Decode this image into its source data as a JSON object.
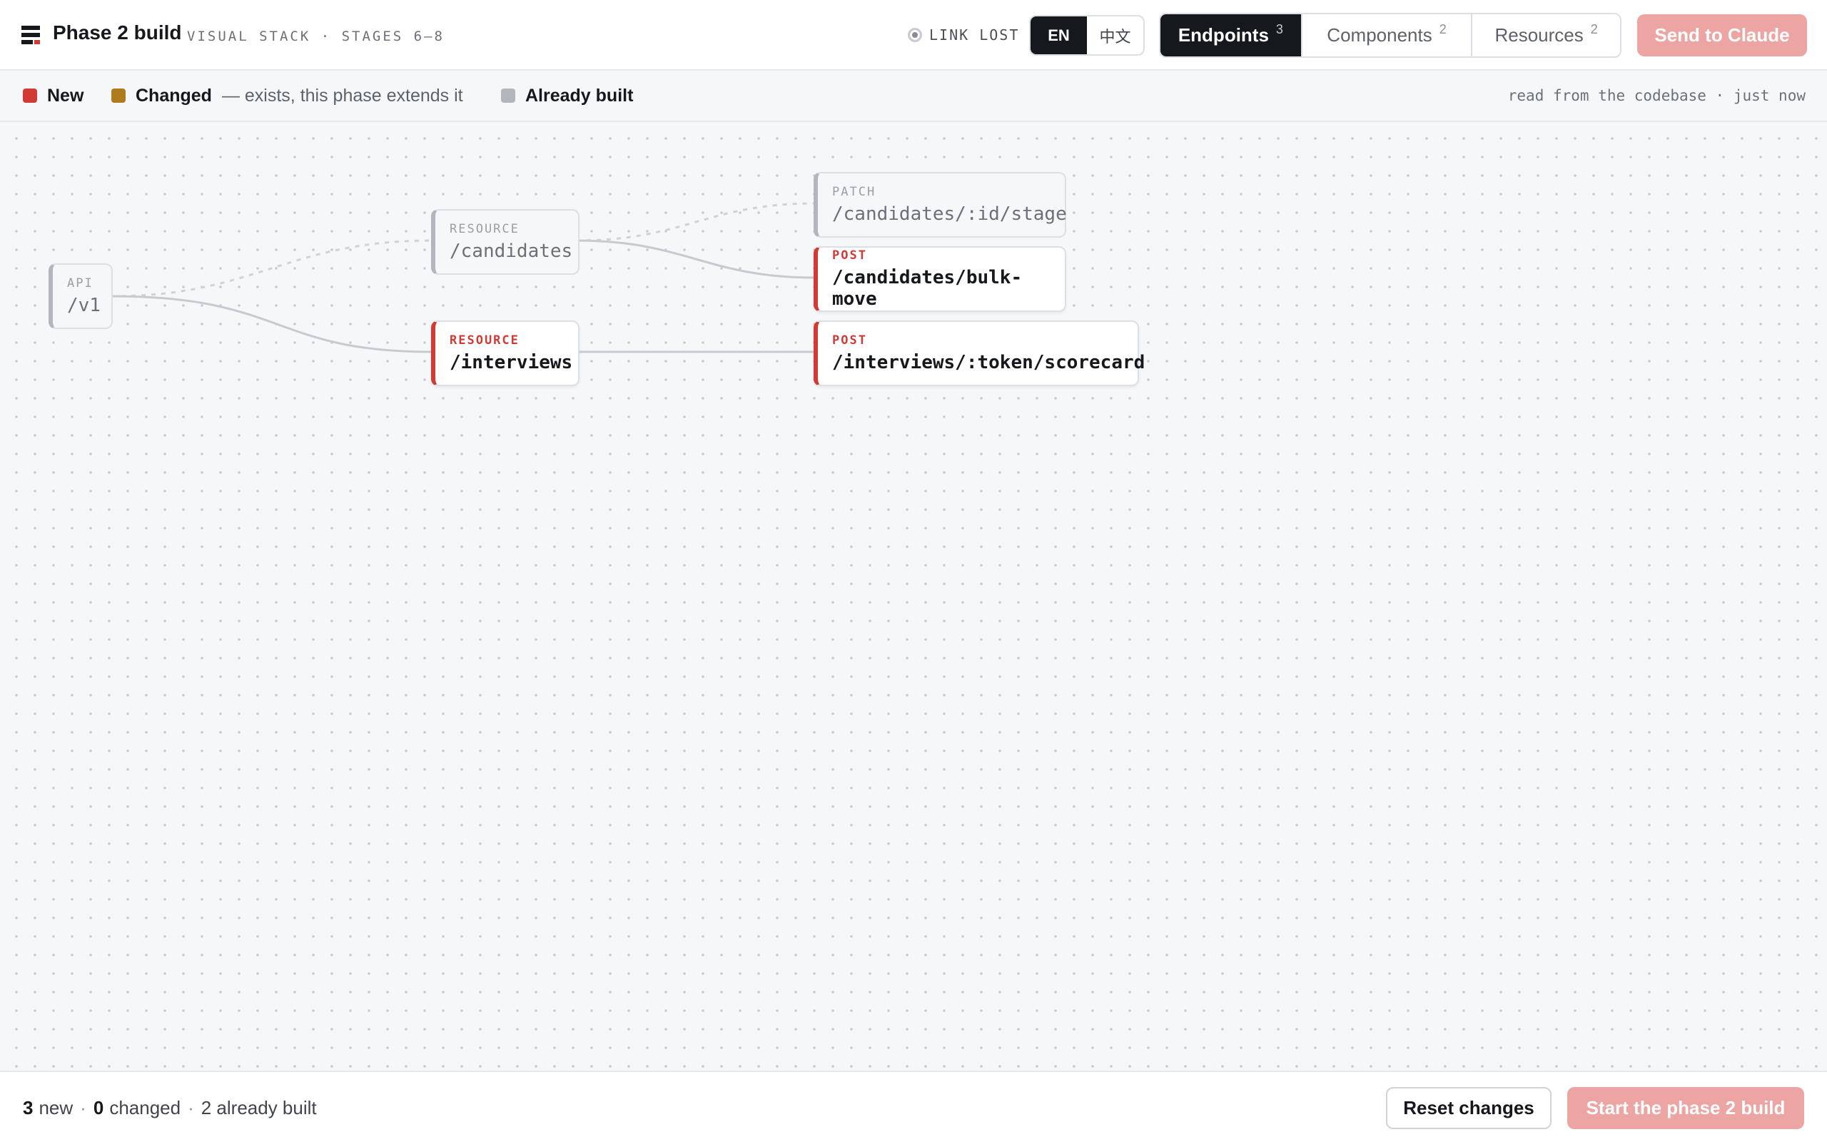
{
  "header": {
    "title": "Phase 2 build",
    "subtitle": "VISUAL STACK · STAGES 6–8",
    "link_status": "LINK LOST",
    "languages": [
      "EN",
      "中文"
    ],
    "active_language": "EN",
    "tabs": [
      {
        "label": "Endpoints",
        "count": "3",
        "active": true
      },
      {
        "label": "Components",
        "count": "2",
        "active": false
      },
      {
        "label": "Resources",
        "count": "2",
        "active": false
      }
    ],
    "send_label": "Send to Claude"
  },
  "legend": {
    "new_label": "New",
    "changed_label": "Changed",
    "changed_note": "— exists, this phase extends it",
    "built_label": "Already built",
    "source": "read from the codebase · just now",
    "colors": {
      "new": "#d23a35",
      "changed": "#b07a1e",
      "built": "#b3b6bc"
    }
  },
  "nodes": [
    {
      "id": "api",
      "kind": "API",
      "path": "/v1",
      "status": "built"
    },
    {
      "id": "candidates",
      "kind": "RESOURCE",
      "path": "/candidates",
      "status": "built"
    },
    {
      "id": "interviews",
      "kind": "RESOURCE",
      "path": "/interviews",
      "status": "new"
    },
    {
      "id": "stage",
      "kind": "PATCH",
      "path": "/candidates/:id/stage",
      "status": "built"
    },
    {
      "id": "bulk",
      "kind": "POST",
      "path": "/candidates/bulk-move",
      "status": "new"
    },
    {
      "id": "scorecard",
      "kind": "POST",
      "path": "/interviews/:token/scorecard",
      "status": "new"
    }
  ],
  "footer": {
    "new_count": "3",
    "new_text": "new",
    "changed_count": "0",
    "changed_text": "changed",
    "built_text": "2 already built",
    "reset_label": "Reset changes",
    "start_label": "Start the phase 2 build"
  }
}
